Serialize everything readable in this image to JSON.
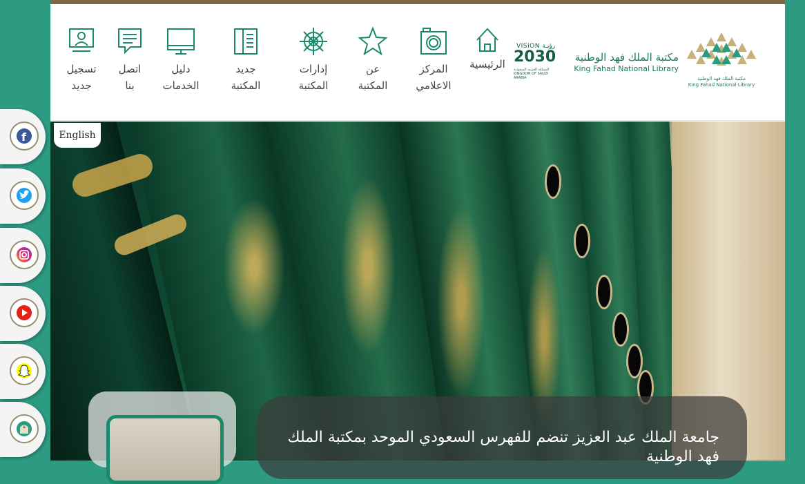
{
  "header": {
    "library_name_ar": "مكتبة الملك فهد الوطنية",
    "library_name_en": "King Fahad National Library",
    "logo_caption_ar": "مكتبة الملك فهد الوطنية",
    "logo_caption_en": "King Fahad National Library",
    "vision": {
      "label": "VISION",
      "ar": "رؤيـة",
      "year": "2030",
      "sub": "المملكة العربية السعودية KINGDOM OF SAUDI ARABIA"
    },
    "home_label": "الرئيسية"
  },
  "nav": [
    {
      "line1": "المركز",
      "line2": "الاعلامي",
      "icon": "camera-icon"
    },
    {
      "line1": "عن",
      "line2": "المكتبة",
      "icon": "star-icon"
    },
    {
      "line1": "إدارات",
      "line2": "المكتبة",
      "icon": "ship-wheel-icon"
    },
    {
      "line1": "جديد",
      "line2": "المكتبة",
      "icon": "book-icon"
    },
    {
      "line1": "دليل",
      "line2": "الخدمات",
      "icon": "monitor-icon"
    },
    {
      "line1": "اتصل",
      "line2": "بنا",
      "icon": "chat-icon"
    },
    {
      "line1": "تسجيل",
      "line2": "جديد",
      "icon": "user-register-icon"
    }
  ],
  "language_toggle": "English",
  "social": [
    "facebook-icon",
    "twitter-icon",
    "instagram-icon",
    "youtube-icon",
    "snapchat-icon",
    "library-app-icon"
  ],
  "news": {
    "title": "جامعة الملك عبد العزيز تنضم للفهرس السعودي الموحد بمكتبة الملك فهد الوطنية"
  },
  "colors": {
    "brand_green": "#2d9a82",
    "dark_green": "#1b7a5c",
    "gold": "#7d6a43"
  }
}
